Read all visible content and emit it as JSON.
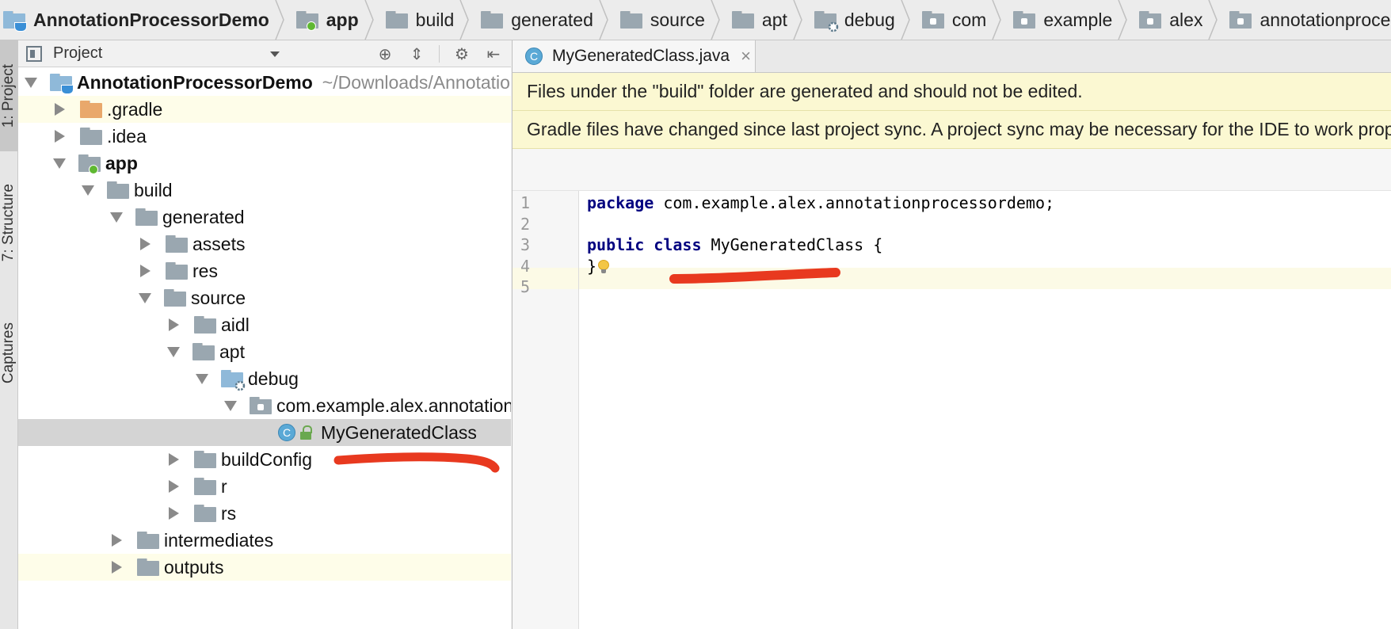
{
  "breadcrumb": [
    {
      "label": "AnnotationProcessorDemo",
      "bold": true,
      "icon": "project-folder-icon"
    },
    {
      "label": "app",
      "bold": true,
      "icon": "module-folder-icon"
    },
    {
      "label": "build",
      "icon": "folder-icon"
    },
    {
      "label": "generated",
      "icon": "folder-icon"
    },
    {
      "label": "source",
      "icon": "folder-icon"
    },
    {
      "label": "apt",
      "icon": "folder-icon"
    },
    {
      "label": "debug",
      "icon": "generated-source-folder-icon"
    },
    {
      "label": "com",
      "icon": "package-icon"
    },
    {
      "label": "example",
      "icon": "package-icon"
    },
    {
      "label": "alex",
      "icon": "package-icon"
    },
    {
      "label": "annotationprocessordemo",
      "icon": "package-icon"
    }
  ],
  "toolstrip": {
    "project": "1: Project",
    "structure": "7: Structure",
    "captures": "Captures"
  },
  "project_panel": {
    "title": "Project",
    "tree": [
      {
        "label": "AnnotationProcessorDemo",
        "path": "~/Downloads/AnnotationProcessorDemo",
        "level": 0,
        "arrow": "down",
        "bold": true,
        "icon": "project"
      },
      {
        "label": ".gradle",
        "level": 1,
        "arrow": "right",
        "icon": "orange",
        "highlight": true
      },
      {
        "label": ".idea",
        "level": 1,
        "arrow": "right",
        "icon": "folder"
      },
      {
        "label": "app",
        "level": 1,
        "arrow": "down",
        "bold": true,
        "icon": "module"
      },
      {
        "label": "build",
        "level": 2,
        "arrow": "down",
        "icon": "folder"
      },
      {
        "label": "generated",
        "level": 3,
        "arrow": "down",
        "icon": "folder"
      },
      {
        "label": "assets",
        "level": 4,
        "arrow": "right",
        "icon": "folder"
      },
      {
        "label": "res",
        "level": 4,
        "arrow": "right",
        "icon": "folder"
      },
      {
        "label": "source",
        "level": 4,
        "arrow": "down",
        "icon": "folder"
      },
      {
        "label": "aidl",
        "level": 5,
        "arrow": "right",
        "icon": "folder"
      },
      {
        "label": "apt",
        "level": 5,
        "arrow": "down",
        "icon": "folder"
      },
      {
        "label": "debug",
        "level": 6,
        "arrow": "down",
        "icon": "generated"
      },
      {
        "label": "com.example.alex.annotationprocessordemo",
        "level": 7,
        "arrow": "down",
        "icon": "package"
      },
      {
        "label": "MyGeneratedClass",
        "level": 8,
        "arrow": "none",
        "icon": "class",
        "selected": true
      },
      {
        "label": "buildConfig",
        "level": 5,
        "arrow": "right",
        "icon": "folder"
      },
      {
        "label": "r",
        "level": 5,
        "arrow": "right",
        "icon": "folder"
      },
      {
        "label": "rs",
        "level": 5,
        "arrow": "right",
        "icon": "folder"
      },
      {
        "label": "intermediates",
        "level": 3,
        "arrow": "right",
        "icon": "folder"
      },
      {
        "label": "outputs",
        "level": 3,
        "arrow": "right",
        "icon": "folder",
        "highlight": true
      }
    ]
  },
  "editor": {
    "tab": {
      "label": "MyGeneratedClass.java",
      "icon_letter": "C"
    },
    "banners": [
      "Files under the \"build\" folder are generated and should not be edited.",
      "Gradle files have changed since last project sync. A project sync may be necessary for the IDE to work properly."
    ],
    "lines": [
      {
        "num": "1",
        "kw": "package",
        "text": " com.example.alex.annotationprocessordemo;"
      },
      {
        "num": "2",
        "kw": "",
        "text": ""
      },
      {
        "num": "3",
        "kw": "public class",
        "text": " MyGeneratedClass {"
      },
      {
        "num": "4",
        "kw": "",
        "text": "}"
      },
      {
        "num": "5",
        "kw": "",
        "text": ""
      }
    ]
  },
  "colors": {
    "annotation_stroke": "#e8391f",
    "banner_bg": "#fbf8d2",
    "keyword": "#000080"
  }
}
